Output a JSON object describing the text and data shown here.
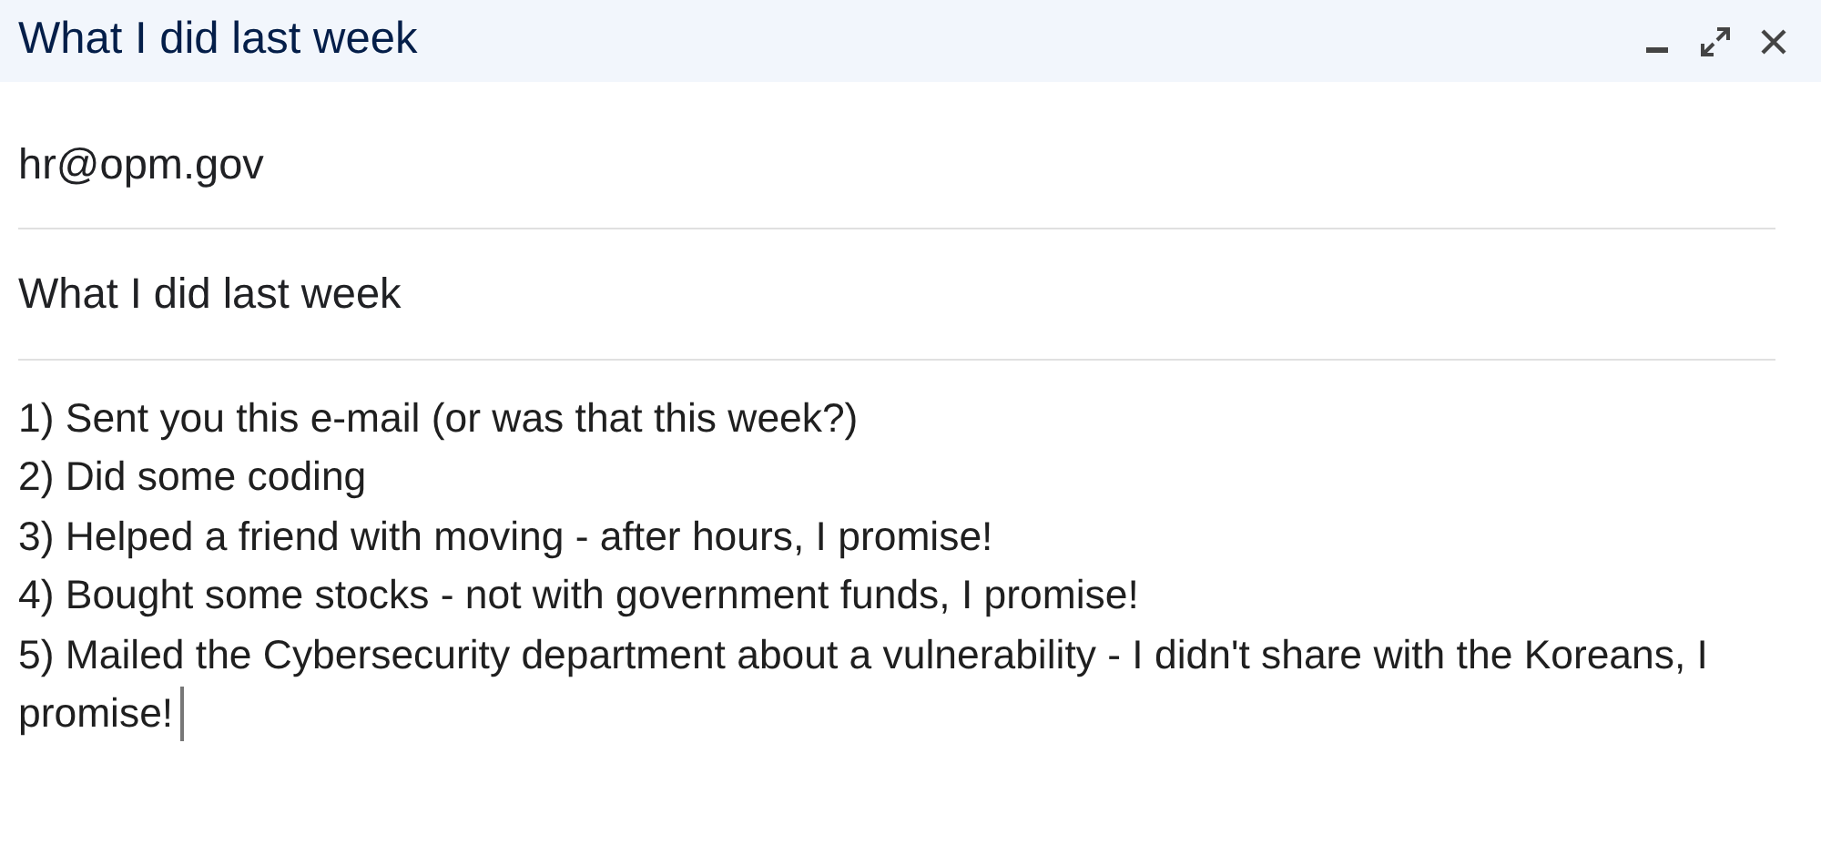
{
  "window": {
    "title": "What I did last week",
    "controls": [
      {
        "kind": "minimize"
      },
      {
        "kind": "expand"
      },
      {
        "kind": "close"
      }
    ]
  },
  "to": "hr@opm.gov",
  "subject": "What I did last week",
  "body": {
    "focused": true,
    "lines": [
      "1) Sent you this e-mail (or was that this week?)",
      "2) Did some coding",
      "3) Helped a friend with moving - after hours, I promise!",
      "4) Bought some stocks - not with government funds, I promise!",
      "5) Mailed the Cybersecurity department about a vulnerability - I didn't share with the Koreans, I promise!"
    ]
  }
}
